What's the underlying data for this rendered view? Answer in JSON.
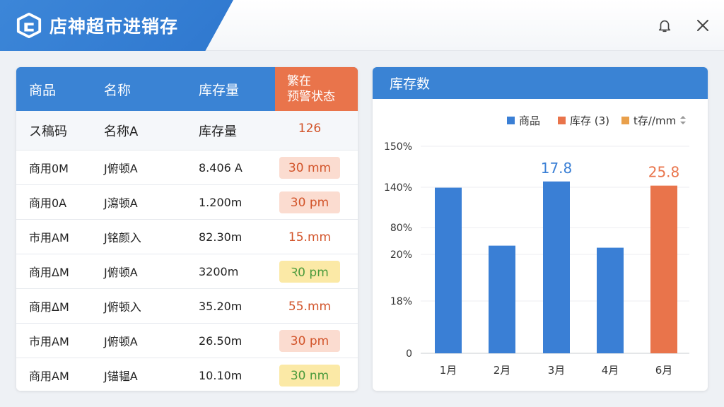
{
  "app": {
    "title": "店神超市进销存",
    "logo_icon": "shop-logo-icon",
    "bell_icon": "bell-icon",
    "close_icon": "close-icon"
  },
  "colors": {
    "brand": "#3a83d4",
    "accent": "#e9744b",
    "badge_pink": "#fbdcd0",
    "badge_yellow": "#fbe9a6"
  },
  "table": {
    "headers": [
      "商品",
      "名称",
      "库存量"
    ],
    "warn_header_line1": "繁在",
    "warn_header_line2": "预警状态",
    "rows": [
      {
        "c1": "ス稿码",
        "c2": "名称A",
        "c3": "库存量",
        "status": "126",
        "style": "plain"
      },
      {
        "c1": "商用0M",
        "c2": "J俯顿A",
        "c3": "8.406 A",
        "status": "30 mm",
        "style": "pink"
      },
      {
        "c1": "商用0A",
        "c2": "J瀉顿A",
        "c3": "1.200m",
        "status": "30 pm",
        "style": "pink"
      },
      {
        "c1": "市用AM",
        "c2": "J铭颜入",
        "c3": "82.30m",
        "status": "15.mm",
        "style": "plain"
      },
      {
        "c1": "商用ΔM",
        "c2": "J俯顿A",
        "c3": "3200m",
        "status": "Ꝛ0 pm",
        "style": "yellow"
      },
      {
        "c1": "商用ΔM",
        "c2": "J俯顿入",
        "c3": "35.20m",
        "status": "55.mm",
        "style": "plain"
      },
      {
        "c1": "市用AM",
        "c2": "J俯顿A",
        "c3": "26.50m",
        "status": "30 pm",
        "style": "pink"
      },
      {
        "c1": "商用AM",
        "c2": "J锚韫A",
        "c3": "10.10m",
        "status": "30 nm",
        "style": "yellow"
      }
    ]
  },
  "chart_panel": {
    "title": "库存数",
    "legend": [
      {
        "label": "商品",
        "color": "#3a7fd5"
      },
      {
        "label": "库存 (3)",
        "color": "#e9744b"
      },
      {
        "label": "t存//mm",
        "color": "#e9a04b"
      }
    ]
  },
  "chart_data": {
    "type": "bar",
    "title": "库存数",
    "y_tick_labels": [
      "150%",
      "140%",
      "80%",
      "20%",
      "18%",
      "0"
    ],
    "categories": [
      "1月",
      "2月",
      "3月",
      "4月",
      "6月"
    ],
    "values": [
      0.8,
      0.52,
      0.83,
      0.51,
      0.81
    ],
    "data_labels": [
      "",
      "",
      "17.8",
      "",
      "25.8"
    ],
    "bar_colors": [
      "#3a7fd5",
      "#3a7fd5",
      "#3a7fd5",
      "#3a7fd5",
      "#e9744b"
    ],
    "label_colors": [
      "#3a7fd5",
      "#3a7fd5",
      "#3a7fd5",
      "#3a7fd5",
      "#e9744b"
    ],
    "ylim": [
      0,
      1
    ],
    "grid": true,
    "legend_position": "top-right"
  }
}
